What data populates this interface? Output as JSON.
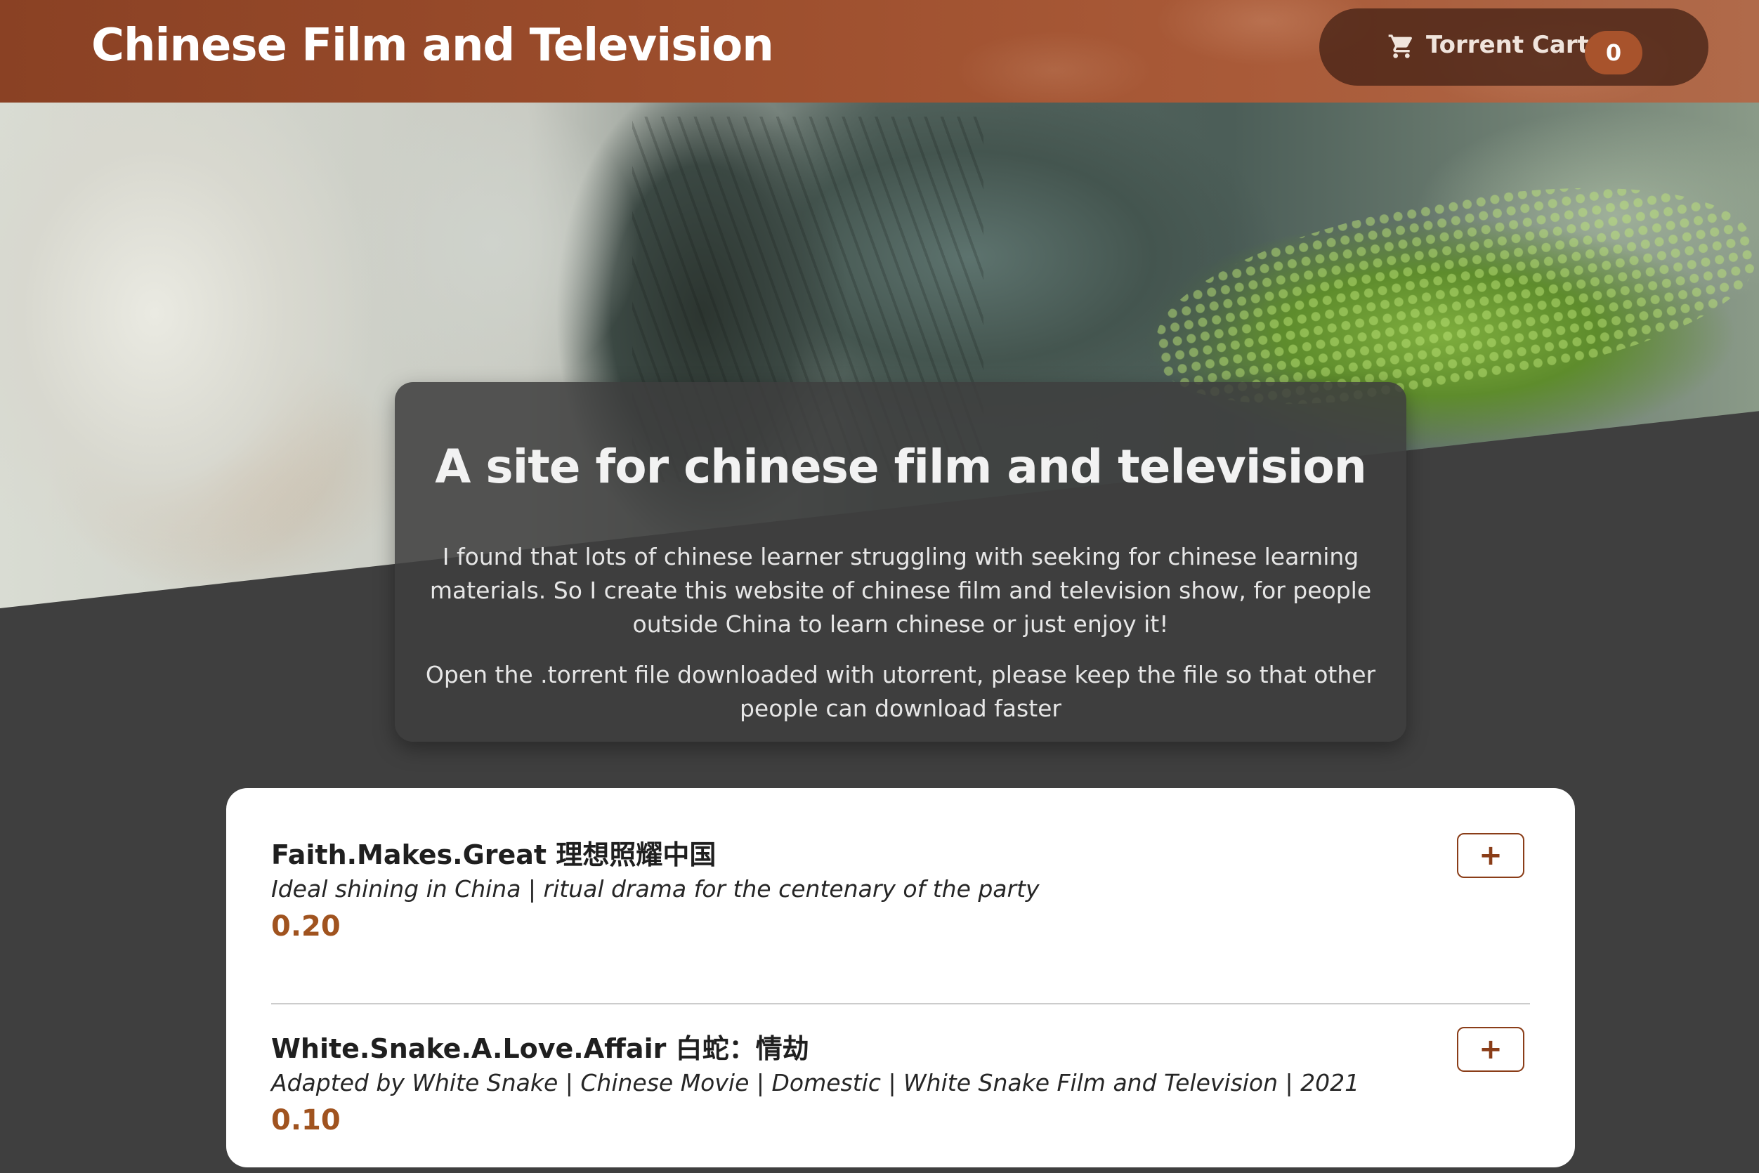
{
  "header": {
    "site_title": "Chinese Film and Television",
    "cart": {
      "label": "Torrent Cart",
      "count": "0",
      "icon": "cart-icon"
    }
  },
  "hero": {
    "title": "A site for chinese film and television",
    "paragraphs": [
      "I found that lots of chinese learner struggling with seeking for chinese learning materials. So I create this website of chinese film and television show, for people outside China to learn chinese or just enjoy it!",
      "Open the .torrent file downloaded with utorrent, please keep the file so that other people can download faster"
    ]
  },
  "products": [
    {
      "title": "Faith.Makes.Great 理想照耀中国",
      "description": "Ideal shining in China | ritual drama for the centenary of the party",
      "price": "0.20",
      "add_label": "+"
    },
    {
      "title": "White.Snake.A.Love.Affair 白蛇：情劫",
      "description": "Adapted by White Snake | Chinese Movie | Domestic | White Snake Film and Television | 2021",
      "price": "0.10",
      "add_label": "+"
    }
  ],
  "colors": {
    "header": "#9a4c2b",
    "accent": "#a8532c",
    "price": "#a0531f",
    "page_background": "#3f3f3f"
  }
}
